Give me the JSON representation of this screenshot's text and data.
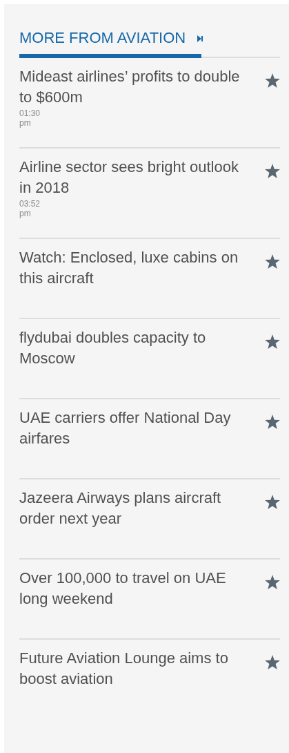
{
  "heading": "MORE FROM AVIATION",
  "articles": [
    {
      "title": "Mideast airlines’ profits to double to $600m",
      "time": "01:30 pm"
    },
    {
      "title": "Airline sector sees bright outlook in 2018",
      "time": "03:52 pm"
    },
    {
      "title": "Watch: Enclosed, luxe cabins on this aircraft"
    },
    {
      "title": "flydubai doubles capacity to Moscow"
    },
    {
      "title": "UAE carriers offer National Day airfares"
    },
    {
      "title": "Jazeera Airways plans aircraft order next year"
    },
    {
      "title": "Over 100,000 to travel on UAE long weekend"
    },
    {
      "title": "Future Aviation Lounge aims to boost aviation"
    }
  ]
}
